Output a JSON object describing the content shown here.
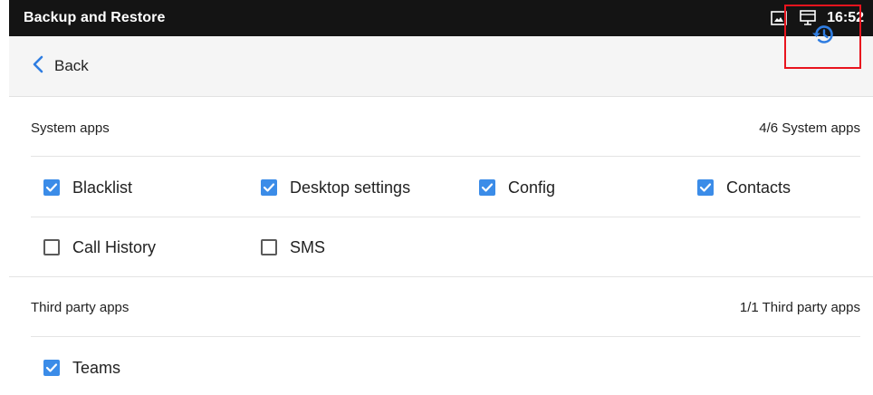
{
  "statusbar": {
    "title": "Backup and Restore",
    "time": "16:52",
    "icons": [
      "screenshot-icon",
      "desktop-icon"
    ]
  },
  "toolbar": {
    "back_label": "Back",
    "restore_icon": "history-icon"
  },
  "system_apps": {
    "label": "System apps",
    "count": "4/6  System apps",
    "items": [
      {
        "label": "Blacklist",
        "checked": true
      },
      {
        "label": "Desktop settings",
        "checked": true
      },
      {
        "label": "Config",
        "checked": true
      },
      {
        "label": "Contacts",
        "checked": true
      },
      {
        "label": "Call History",
        "checked": false
      },
      {
        "label": "SMS",
        "checked": false
      }
    ]
  },
  "third_party_apps": {
    "label": "Third party apps",
    "count": "1/1  Third party apps",
    "items": [
      {
        "label": "Teams",
        "checked": true
      }
    ]
  },
  "colors": {
    "checkbox_checked": "#3b8ce8",
    "accent": "#2f7de1",
    "highlight_border": "#e8141e",
    "statusbar_bg": "#141414"
  }
}
